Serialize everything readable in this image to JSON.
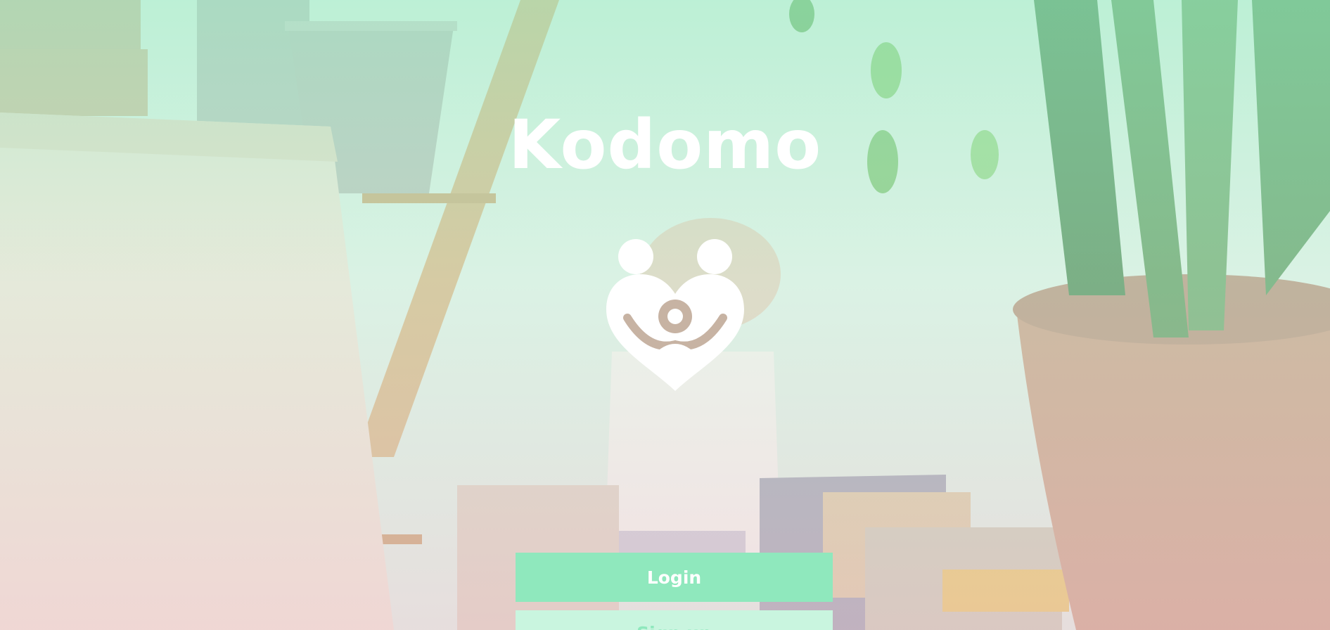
{
  "app": {
    "title": "Kodomo"
  },
  "logo": {
    "icon": "family-heart-logo-icon"
  },
  "actions": {
    "login_label": "Login",
    "signup_label": "Sign up"
  },
  "colors": {
    "primary": "#8fe8bd",
    "secondary": "#c9f5df",
    "text_on_primary": "#ffffff"
  }
}
